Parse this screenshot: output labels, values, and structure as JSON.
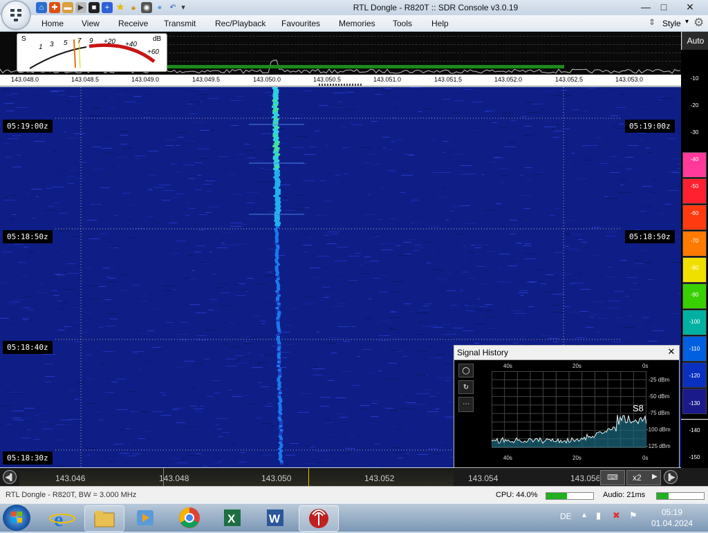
{
  "window": {
    "title": "RTL Dongle - R820T :: SDR Console v3.0.19",
    "controls": {
      "minimize": "—",
      "maximize": "□",
      "close": "✕"
    }
  },
  "menu": {
    "items": [
      "Home",
      "View",
      "Receive",
      "Transmit",
      "Rec/Playback",
      "Favourites",
      "Memories",
      "Tools",
      "Help"
    ],
    "style_label": "Style"
  },
  "smeter": {
    "s_label": "S",
    "db_label": "dB",
    "s_ticks": [
      "1",
      "3",
      "5",
      "7",
      "9"
    ],
    "db_ticks": [
      "+20",
      "+40",
      "+60"
    ]
  },
  "spectrum": {
    "auto_label": "Auto",
    "freq_ticks": [
      "143.048.0",
      "143.048.5",
      "143.049.0",
      "143.049.5",
      "143.050.0",
      "143.050.5",
      "143.051.0",
      "143.051.5",
      "143.052.0",
      "143.052.5",
      "143.053.0"
    ]
  },
  "db_scale": {
    "labels": [
      "-10",
      "-20",
      "-30",
      "-40",
      "-50",
      "-60",
      "-70",
      "-80",
      "-90",
      "-100",
      "-110",
      "-120",
      "-130",
      "-140",
      "-150"
    ],
    "colors": [
      "#ff3a9a",
      "#ff2030",
      "#ff3a10",
      "#ff7a00",
      "#f0e000",
      "#38d000",
      "#00b0a0",
      "#0060e0",
      "#0a30c0",
      "#1a1a8a"
    ]
  },
  "waterfall": {
    "time_labels": [
      "05:19:00z",
      "05:18:50z",
      "05:18:40z",
      "05:18:30z"
    ]
  },
  "signal_history": {
    "title": "Signal History",
    "close": "✕",
    "top_axis": [
      "40s",
      "20s",
      "0s"
    ],
    "bottom_axis": [
      "40s",
      "20s",
      "0s"
    ],
    "y_axis": [
      "-25 dBm",
      "-50 dBm",
      "-75 dBm",
      "-100 dBm",
      "-125 dBm"
    ],
    "s_reading": "S8",
    "buttons": [
      "◯",
      "↻",
      "⋯"
    ]
  },
  "bottom_ruler": {
    "freqs": [
      "143.046",
      "143.048",
      "143.050",
      "143.052",
      "143.054",
      "143.056"
    ],
    "zoom_label": "x2"
  },
  "status": {
    "device": "RTL Dongle - R820T, BW = 3.000 MHz",
    "cpu_label": "CPU: 44.0%",
    "cpu_fraction": 0.44,
    "audio_label": "Audio: 21ms",
    "audio_fraction": 0.25
  },
  "taskbar": {
    "lang": "DE",
    "time": "05:19",
    "date": "01.04.2024",
    "apps": [
      "start-orb",
      "internet-explorer",
      "file-explorer",
      "media-player",
      "chrome",
      "excel",
      "word",
      "sdr-console"
    ]
  }
}
